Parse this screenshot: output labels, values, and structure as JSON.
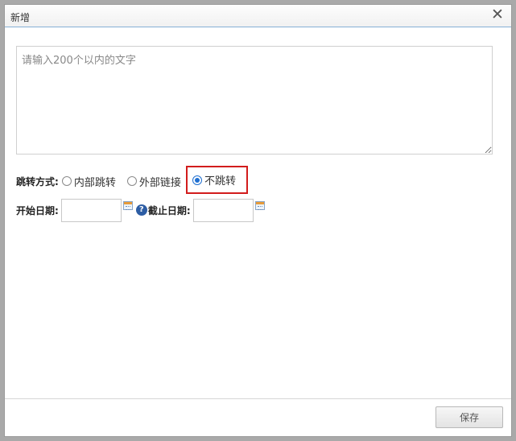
{
  "dialog": {
    "title": "新增",
    "close_symbol": "✕"
  },
  "content": {
    "placeholder": "请输入200个以内的文字",
    "value": ""
  },
  "jump": {
    "label": "跳转方式:",
    "options": [
      {
        "label": "内部跳转",
        "checked": false
      },
      {
        "label": "外部链接",
        "checked": false
      },
      {
        "label": "不跳转",
        "checked": true
      }
    ]
  },
  "dates": {
    "start_label": "开始日期:",
    "start_value": "",
    "end_label": "截止日期:",
    "end_value": "",
    "help_symbol": "?"
  },
  "footer": {
    "save_label": "保存"
  },
  "colors": {
    "highlight": "#d21c1c",
    "radio_accent": "#1f6fd1",
    "help_icon": "#2d5da4"
  },
  "icons": [
    "close-icon",
    "calendar-icon",
    "help-icon"
  ]
}
